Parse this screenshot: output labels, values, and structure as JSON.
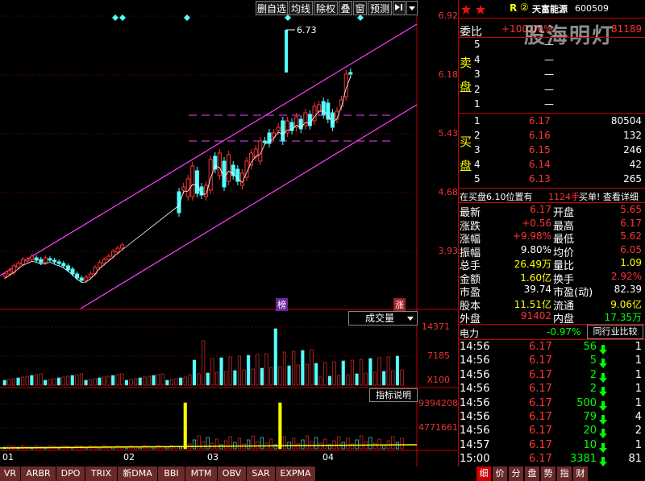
{
  "toolbar": {
    "buttons": [
      "删自选",
      "均线",
      "除权",
      "叠",
      "窗",
      "预测"
    ],
    "nav_icon": "arrow-right-bar-icon",
    "menu_icon": "triangle-down-icon"
  },
  "chart": {
    "y_ticks": [
      "6.92",
      "6.18",
      "5.43",
      "4.68",
      "3.93"
    ],
    "peak_label": "6.73",
    "marker_bang": "榜",
    "marker_zhang": "涨",
    "x_months": [
      "01",
      "02",
      "03",
      "04"
    ],
    "volume_label": "成交量",
    "volume_ticks": [
      "14371",
      "7185",
      "X100"
    ],
    "indicator_button": "指标说明",
    "indicator_ticks": [
      "9394208",
      "4771661"
    ],
    "colors": {
      "up": "#ff3232",
      "down": "#54ffff",
      "channel": "#ff3cff",
      "grid": "#8a0000",
      "ma": "#ffffff"
    }
  },
  "chart_data": {
    "type": "candlestick",
    "x_ticks": [
      "01",
      "02",
      "03",
      "04"
    ],
    "ylim": [
      3.56,
      7.0
    ],
    "y_ticks": [
      6.92,
      6.18,
      5.43,
      4.68,
      3.93
    ],
    "annotations": [
      "6.73"
    ],
    "series": [
      {
        "name": "成交量",
        "ticks": [
          14371,
          7185
        ],
        "unit": "X100"
      }
    ]
  },
  "indicator_tabs": [
    "VR",
    "ARBR",
    "DPO",
    "TRIX",
    "新DMA",
    "BBI",
    "MTM",
    "OBV",
    "SAR",
    "EXPMA"
  ],
  "right_panel": {
    "header": {
      "r": "R",
      "circle_num": "②",
      "name": "天富能源",
      "code": "600509"
    },
    "ratio_label": "委比",
    "ratio_value": "+100.00%",
    "ratio_count": "81189",
    "sell_label_1": "卖",
    "sell_label_2": "盘",
    "buy_label_1": "买",
    "buy_label_2": "盘",
    "sells": [
      {
        "n": "5",
        "p": "—",
        "v": ""
      },
      {
        "n": "4",
        "p": "—",
        "v": ""
      },
      {
        "n": "3",
        "p": "—",
        "v": ""
      },
      {
        "n": "2",
        "p": "—",
        "v": ""
      },
      {
        "n": "1",
        "p": "—",
        "v": ""
      }
    ],
    "buys": [
      {
        "n": "1",
        "p": "6.17",
        "v": "80504"
      },
      {
        "n": "2",
        "p": "6.16",
        "v": "132"
      },
      {
        "n": "3",
        "p": "6.15",
        "v": "246"
      },
      {
        "n": "4",
        "p": "6.14",
        "v": "42"
      },
      {
        "n": "5",
        "p": "6.13",
        "v": "265"
      }
    ],
    "buy_info_left": "在买盘6.10位置有",
    "buy_info_num": "1124手",
    "buy_info_right": "买单! 查看详细",
    "stats": [
      {
        "l": "最新",
        "v": "6.17",
        "l2": "开盘",
        "v2": "5.65"
      },
      {
        "l": "涨跌",
        "v": "+0.56",
        "l2": "最高",
        "v2": "6.17"
      },
      {
        "l": "涨幅",
        "v": "+9.98%",
        "l2": "最低",
        "v2": "5.62"
      },
      {
        "l": "振幅",
        "v": "9.80%",
        "l2": "均价",
        "v2": "6.05"
      },
      {
        "l": "总手",
        "v": "26.49万",
        "l2": "量比",
        "v2": "1.09"
      },
      {
        "l": "金额",
        "v": "1.60亿",
        "l2": "换手",
        "v2": "2.92%"
      },
      {
        "l": "市盈",
        "v": "39.74",
        "l2": "市盈(动)",
        "v2": "82.39"
      },
      {
        "l": "股本",
        "v": "11.51亿",
        "l2": "流通",
        "v2": "9.06亿"
      },
      {
        "l": "外盘",
        "v": "91402",
        "l2": "内盘",
        "v2": "17.35万"
      }
    ],
    "sector_name": "电力",
    "sector_change": "-0.97%",
    "compare_button": "同行业比较",
    "ticks": [
      {
        "t": "14:56",
        "p": "6.17",
        "v": "56",
        "n": "1"
      },
      {
        "t": "14:56",
        "p": "6.17",
        "v": "5",
        "n": "1"
      },
      {
        "t": "14:56",
        "p": "6.17",
        "v": "2",
        "n": "1"
      },
      {
        "t": "14:56",
        "p": "6.17",
        "v": "2",
        "n": "1"
      },
      {
        "t": "14:56",
        "p": "6.17",
        "v": "500",
        "n": "1"
      },
      {
        "t": "14:56",
        "p": "6.17",
        "v": "79",
        "n": "4"
      },
      {
        "t": "14:56",
        "p": "6.17",
        "v": "20",
        "n": "2"
      },
      {
        "t": "14:57",
        "p": "6.17",
        "v": "10",
        "n": "1"
      },
      {
        "t": "15:00",
        "p": "6.17",
        "v": "3381",
        "n": "81"
      }
    ],
    "tabs": [
      "细",
      "价",
      "分",
      "盘",
      "势",
      "指",
      "财"
    ],
    "watermark": "股海明灯"
  }
}
